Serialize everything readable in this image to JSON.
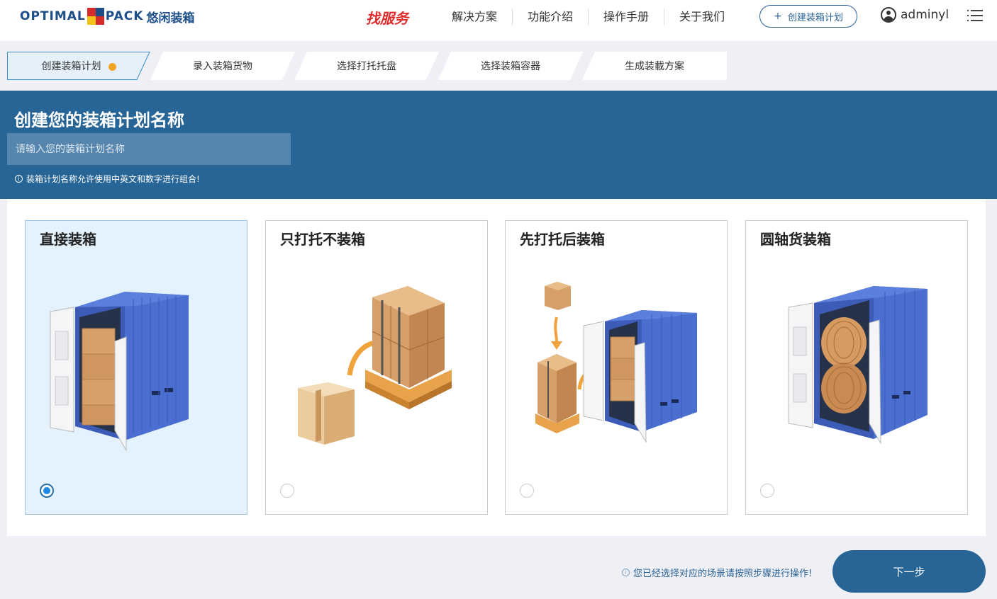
{
  "header": {
    "logo_left": "OPTIMAL",
    "logo_right": "PACK",
    "logo_cn": "悠闲装箱",
    "find_service": "找服务",
    "nav": [
      "解决方案",
      "功能介绍",
      "操作手册",
      "关于我们"
    ],
    "create_plan": "创建装箱计划",
    "username": "adminyl"
  },
  "steps": [
    "创建装箱计划",
    "录入装箱货物",
    "选择打托托盘",
    "选择装箱容器",
    "生成装載方案"
  ],
  "banner": {
    "title": "创建您的装箱计划名称",
    "input_placeholder": "请输入您的装箱计划名称",
    "hint": "装箱计划名称允许使用中英文和数字进行组合!"
  },
  "cards": [
    {
      "title": "直接装箱",
      "selected": true
    },
    {
      "title": "只打托不装箱",
      "selected": false
    },
    {
      "title": "先打托后装箱",
      "selected": false
    },
    {
      "title": "圆轴货装箱",
      "selected": false
    }
  ],
  "footer": {
    "hint": "您已经选择对应的场景请按照步骤进行操作!",
    "next": "下一步"
  },
  "colors": {
    "primary": "#276596",
    "accent_dot": "#f5a623",
    "container_blue": "#4a6fd0",
    "box_tan": "#d7a06a"
  }
}
